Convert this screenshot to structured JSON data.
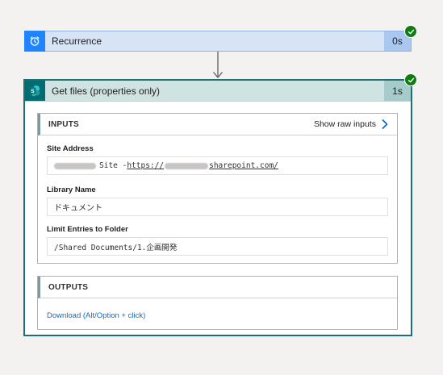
{
  "colors": {
    "recurrence_accent": "#1f85ff",
    "sharepoint_accent": "#036c70",
    "success": "#107c10",
    "link": "#0f6cbd"
  },
  "recurrence_step": {
    "title": "Recurrence",
    "duration": "0s",
    "icon": "alarm-clock-icon",
    "status": "succeeded"
  },
  "getfiles_step": {
    "title": "Get files (properties only)",
    "duration": "1s",
    "icon": "sharepoint-icon",
    "status": "succeeded",
    "inputs": {
      "header": "INPUTS",
      "show_raw_label": "Show raw inputs",
      "site_address": {
        "label": "Site Address",
        "value_prefix": "Site - ",
        "value_url_start": "https://",
        "value_url_end": "sharepoint.com/"
      },
      "library_name": {
        "label": "Library Name",
        "value": "ドキュメント"
      },
      "limit_folder": {
        "label": "Limit Entries to Folder",
        "value": "/Shared Documents/1.企画開発"
      }
    },
    "outputs": {
      "header": "OUTPUTS",
      "download_label": "Download (Alt/Option + click)"
    }
  }
}
